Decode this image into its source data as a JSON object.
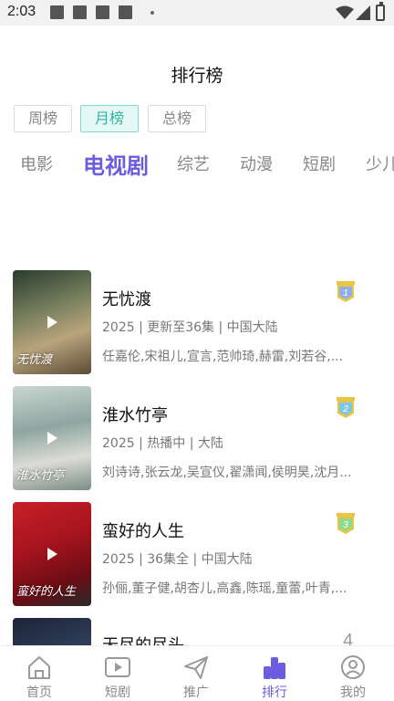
{
  "status_bar": {
    "time": "2:03"
  },
  "header": {
    "title": "排行榜"
  },
  "period_tabs": [
    {
      "label": "周榜",
      "active": false
    },
    {
      "label": "月榜",
      "active": true
    },
    {
      "label": "总榜",
      "active": false
    }
  ],
  "category_tabs": [
    {
      "label": "电影",
      "active": false
    },
    {
      "label": "电视剧",
      "active": true
    },
    {
      "label": "综艺",
      "active": false
    },
    {
      "label": "动漫",
      "active": false
    },
    {
      "label": "短剧",
      "active": false
    },
    {
      "label": "少儿",
      "active": false
    }
  ],
  "items": [
    {
      "rank": "1",
      "title": "无忧渡",
      "meta": "2025 | 更新至36集 | 中国大陆",
      "cast": "任嘉伦,宋祖儿,宣言,范帅琦,赫雷,刘若谷,...",
      "poster_text": "无忧渡",
      "badge_color": "#8fb0e6"
    },
    {
      "rank": "2",
      "title": "淮水竹亭",
      "meta": "2025 | 热播中 | 大陆",
      "cast": "刘诗诗,张云龙,吴宣仪,翟潇闻,侯明昊,沈月...",
      "poster_text": "淮水竹亭",
      "badge_color": "#7cc6e8"
    },
    {
      "rank": "3",
      "title": "蛮好的人生",
      "meta": "2025 | 36集全 | 中国大陆",
      "cast": "孙俪,董子健,胡杏儿,高鑫,陈瑶,童蕾,叶青,...",
      "poster_text": "蛮好的人生",
      "badge_color": "#8fd98a"
    },
    {
      "rank": "4",
      "title": "无尽的尽头",
      "meta": "",
      "cast": "",
      "poster_text": "",
      "badge_color": ""
    }
  ],
  "bottom_nav": [
    {
      "label": "首页",
      "icon": "home-icon",
      "active": false
    },
    {
      "label": "短剧",
      "icon": "video-icon",
      "active": false
    },
    {
      "label": "推广",
      "icon": "send-icon",
      "active": false
    },
    {
      "label": "排行",
      "icon": "ranking-icon",
      "active": true
    },
    {
      "label": "我的",
      "icon": "profile-icon",
      "active": false
    }
  ],
  "colors": {
    "accent": "#6b5ce0",
    "period_active": "#2fb6a2",
    "gold_badge": "#e8c544"
  }
}
